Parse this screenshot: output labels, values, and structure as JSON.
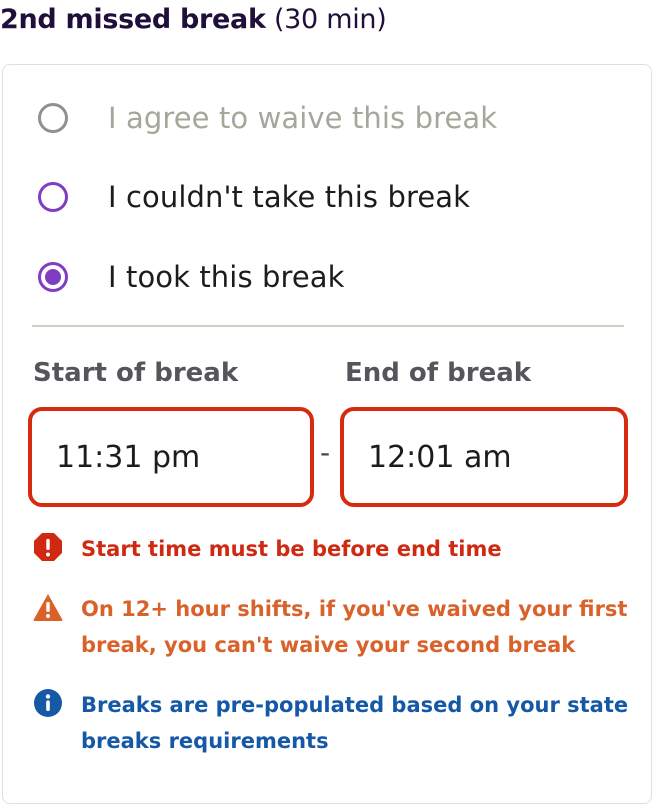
{
  "section": {
    "title_bold": "2nd missed break",
    "title_duration": "(30 min)"
  },
  "options": [
    {
      "label": "I agree to waive this break",
      "state": "disabled"
    },
    {
      "label": "I couldn't take this break",
      "state": "unselected"
    },
    {
      "label": "I took this break",
      "state": "selected"
    }
  ],
  "break_times": {
    "start_label": "Start of break",
    "start_value": "11:31 pm",
    "separator": "-",
    "end_label": "End of break",
    "end_value": "12:01 am"
  },
  "messages": {
    "error": "Start time must be before end time",
    "warning": "On 12+ hour shifts, if you've waived your first break, you can't waive your second break",
    "info": "Breaks are pre-populated based on your state breaks requirements"
  },
  "colors": {
    "accent": "#7e3dc3",
    "error": "#cf2a11",
    "warning": "#d9622b",
    "info": "#1458a6"
  }
}
